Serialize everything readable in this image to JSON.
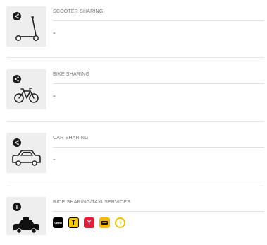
{
  "colors": {
    "tile_background": "#eeeeee",
    "icon_dark": "#1a1a1a",
    "divider": "#e6e6e6",
    "uber": "#000000",
    "yandex_taxi": "#f5c800",
    "yandex_go": "#e51c38",
    "citymobil": "#f6b800",
    "gett": "#f2c500"
  },
  "sections": [
    {
      "title": "SCOOTER SHARING",
      "value": "-",
      "badge_icon": "share-icon",
      "vehicle_icon": "scooter-icon"
    },
    {
      "title": "BIKE SHARING",
      "value": "-",
      "badge_icon": "share-icon",
      "vehicle_icon": "bicycle-icon"
    },
    {
      "title": "CAR SHARING",
      "value": "-",
      "badge_icon": "share-icon",
      "vehicle_icon": "car-icon"
    },
    {
      "title": "RIDE SHARING/TAXI SERVICES",
      "badge_icon": "taxi-letter-icon",
      "vehicle_icon": "taxi-icon",
      "badge_letter": "T",
      "providers": [
        {
          "icon": "uber-logo-icon",
          "label": "UBER"
        },
        {
          "icon": "yandex-taxi-logo-icon",
          "label": "T"
        },
        {
          "icon": "yandex-go-logo-icon",
          "label": "Y"
        },
        {
          "icon": "citymobil-logo-icon",
          "label": ""
        },
        {
          "icon": "gett-logo-icon",
          "label": ""
        }
      ]
    }
  ]
}
